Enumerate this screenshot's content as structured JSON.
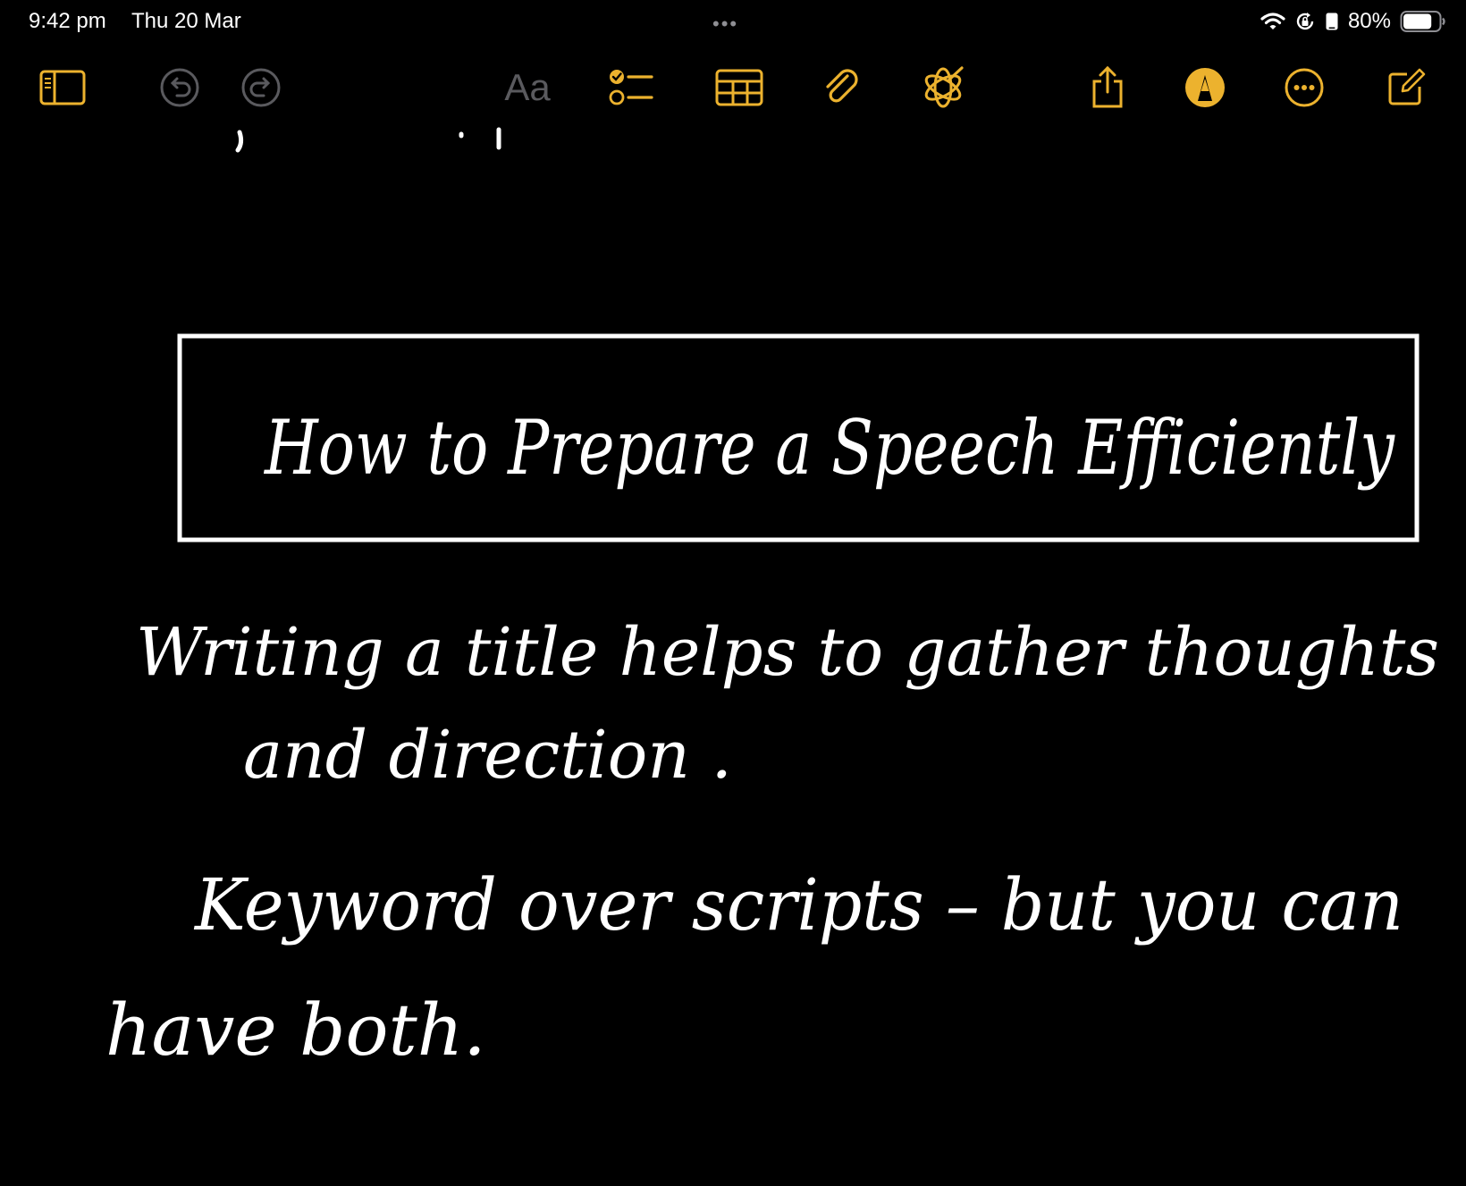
{
  "status_bar": {
    "time": "9:42 pm",
    "date": "Thu 20 Mar",
    "battery_percent": "80%",
    "battery_level": 0.8,
    "icons": [
      "wifi-icon",
      "orientation-lock-icon",
      "phone-icon",
      "battery-icon"
    ]
  },
  "multitask": {
    "dots": "•••"
  },
  "toolbar": {
    "accent_color": "#ecb22e",
    "disabled_color": "#5a5a5e",
    "format_label": "Aa",
    "icons": [
      "sidebar-icon",
      "undo-icon",
      "redo-icon",
      "checklist-icon",
      "table-icon",
      "attachment-icon",
      "writing-tools-icon",
      "share-icon",
      "markup-pen-icon",
      "more-icon",
      "compose-icon"
    ]
  },
  "note": {
    "handwriting_color": "#ffffff",
    "title": "How to Prepare a Speech Efficiently",
    "line_1": "Writing a title helps to gather thoughts",
    "line_2": "and direction .",
    "line_3": "Keyword over scripts – but you can",
    "line_4": "have both."
  }
}
